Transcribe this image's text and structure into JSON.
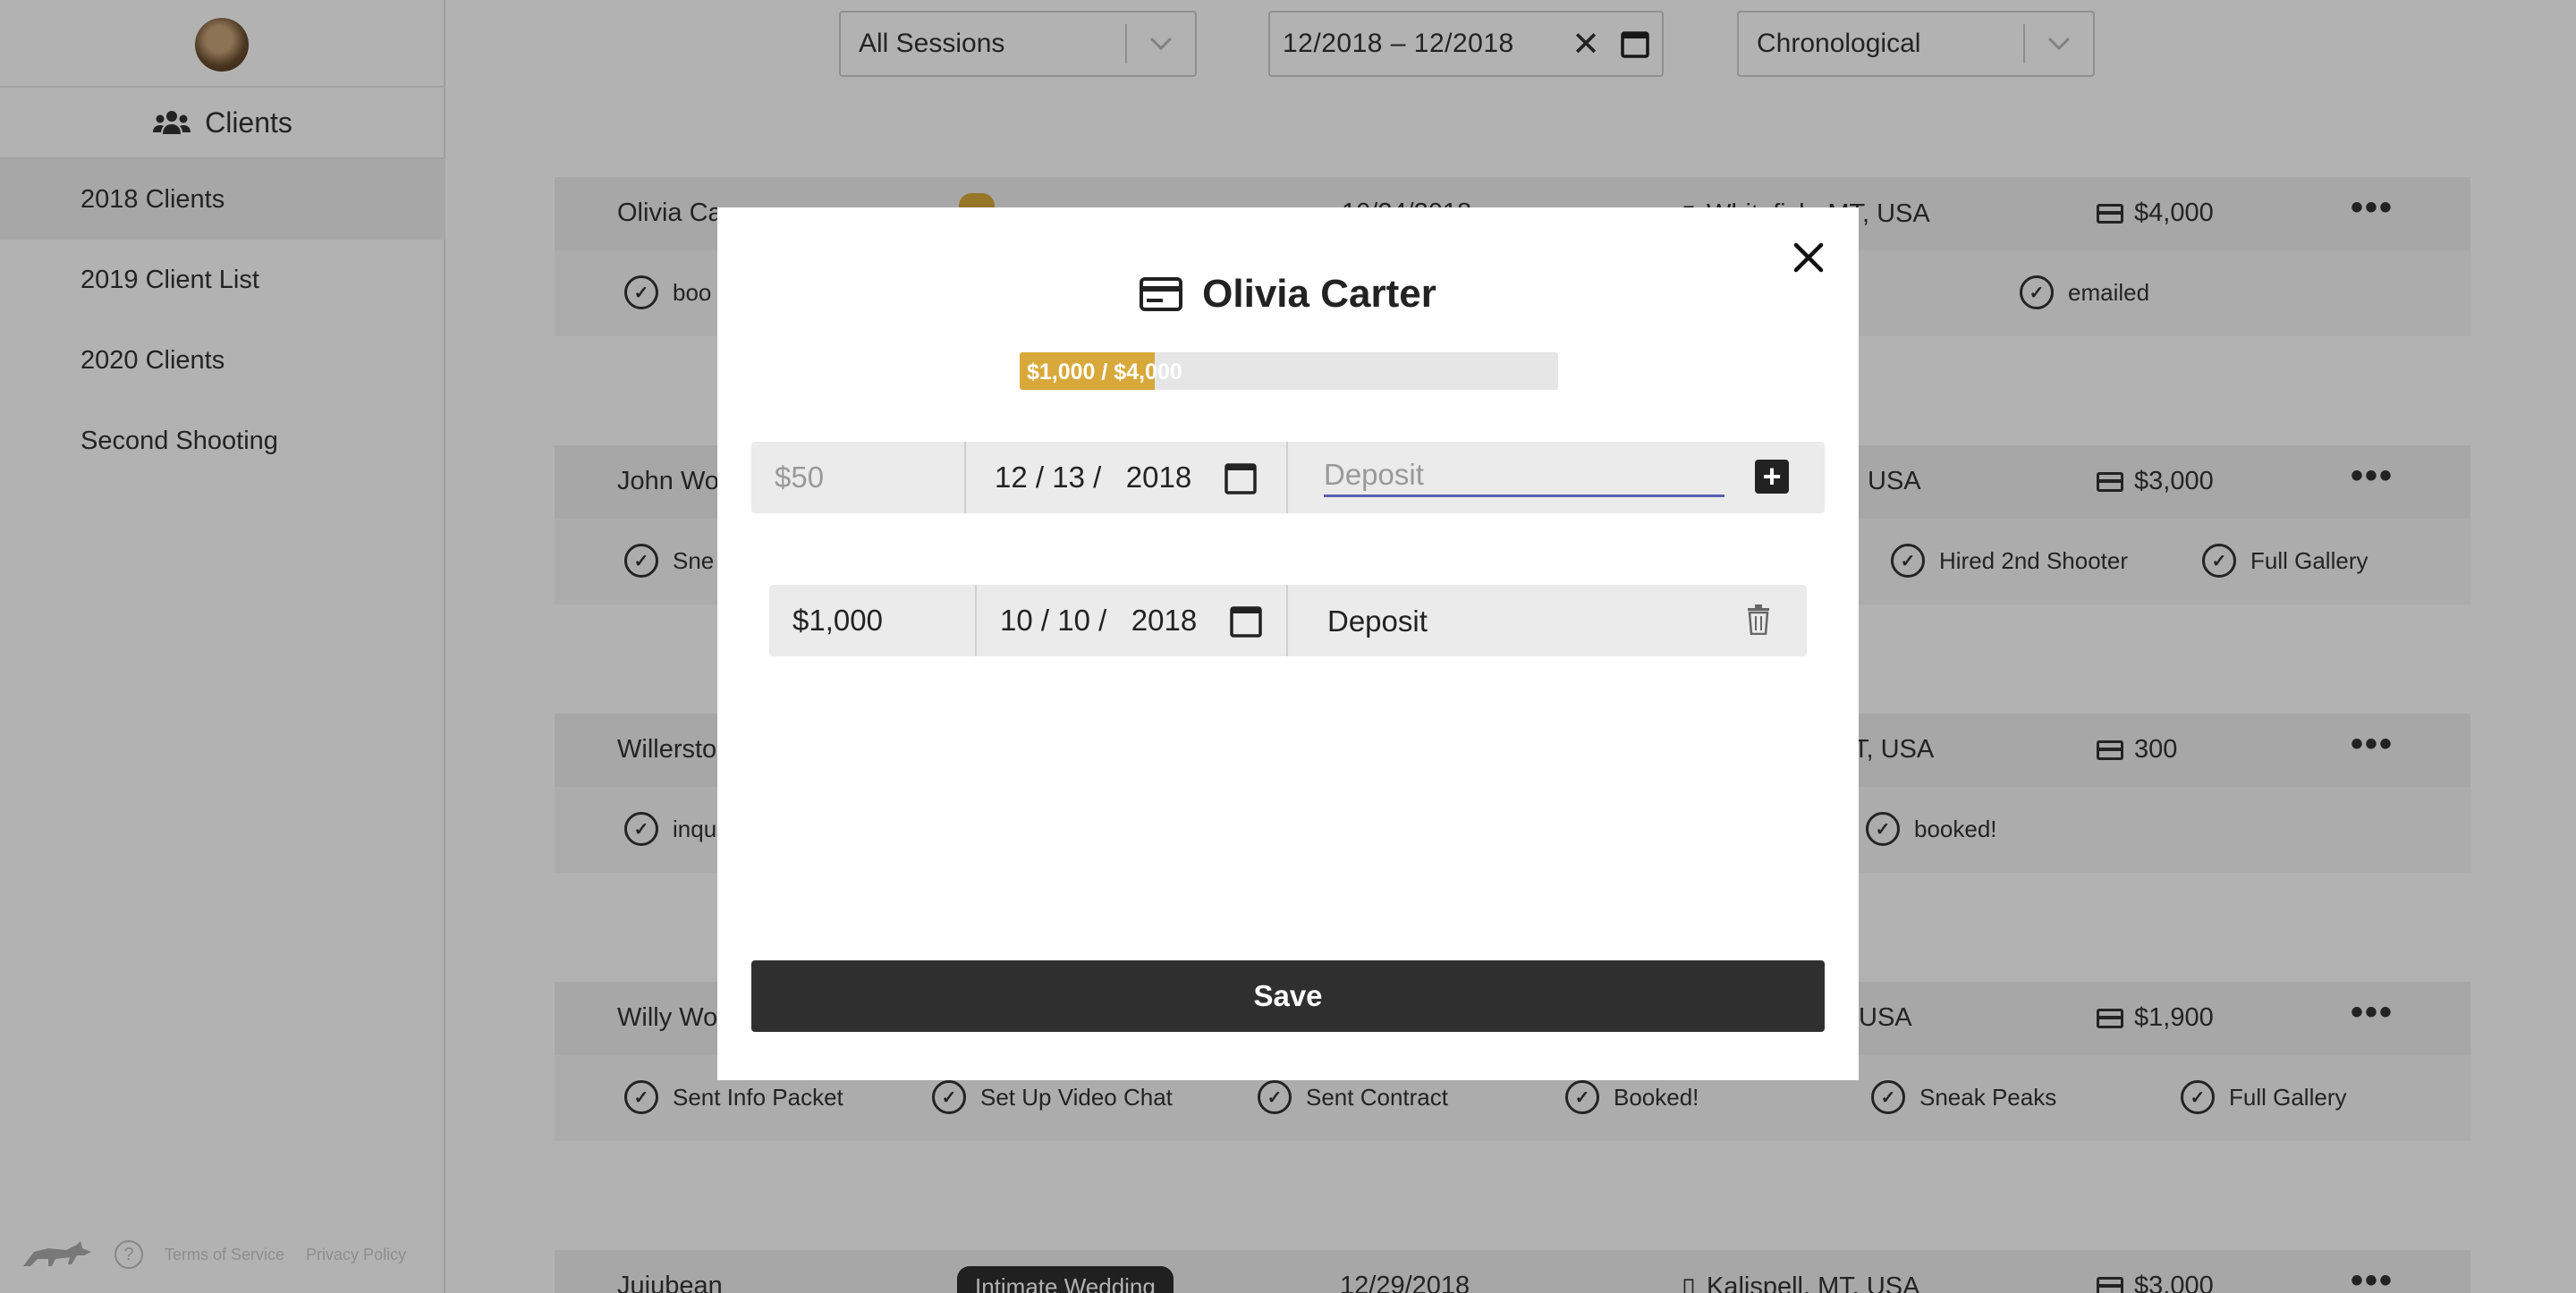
{
  "sidebar": {
    "title": "Clients",
    "items": [
      {
        "label": "2018 Clients"
      },
      {
        "label": "2019 Client List"
      },
      {
        "label": "2020 Clients"
      },
      {
        "label": "Second Shooting"
      }
    ],
    "footer": {
      "terms": "Terms of Service",
      "privacy": "Privacy Policy",
      "help": "?"
    }
  },
  "filters": {
    "sessions": "All Sessions",
    "date_range": "12/2018  – 12/2018",
    "order": "Chronological"
  },
  "clients": [
    {
      "name": "Olivia Ca",
      "date": "10/24/2018",
      "location": "Whitefish, MT, USA",
      "price": "$4,000",
      "checks": [
        {
          "label": "boo"
        },
        {
          "label": "emailed"
        }
      ]
    },
    {
      "name": "John Wo",
      "location": "USA",
      "price": "$3,000",
      "checks": [
        {
          "label": "Sne"
        },
        {
          "label": "Hired 2nd Shooter"
        },
        {
          "label": "Full Gallery"
        }
      ]
    },
    {
      "name": "Willersto",
      "location": "T, USA",
      "price": "300",
      "checks": [
        {
          "label": "inqu"
        },
        {
          "label": "booked!"
        }
      ]
    },
    {
      "name": "Willy Wo",
      "location": "USA",
      "price": "$1,900",
      "checks": [
        {
          "label": "Sent Info Packet"
        },
        {
          "label": "Set Up Video Chat"
        },
        {
          "label": "Sent Contract"
        },
        {
          "label": "Booked!"
        },
        {
          "label": "Sneak Peaks"
        },
        {
          "label": "Full Gallery"
        }
      ]
    },
    {
      "name": "Jujubean",
      "tag": "Intimate Wedding",
      "date": "12/29/2018",
      "location": "Kalispell, MT, USA",
      "price": "$3,000"
    }
  ],
  "modal": {
    "title": "Olivia Carter",
    "progress_text": "$1,000 / $4,000",
    "progress_fraction": 0.25,
    "new_payment": {
      "amount_placeholder": "$50",
      "date": "12 / 13 /   2018",
      "description_placeholder": "Deposit",
      "description_value": ""
    },
    "payments": [
      {
        "amount": "$1,000",
        "date": "10 / 10 /   2018",
        "description": "Deposit"
      }
    ],
    "save_label": "Save"
  },
  "colors": {
    "accent": "#d8a93a",
    "dark": "#2f2f2f",
    "focus_underline": "#5a5fb0"
  }
}
